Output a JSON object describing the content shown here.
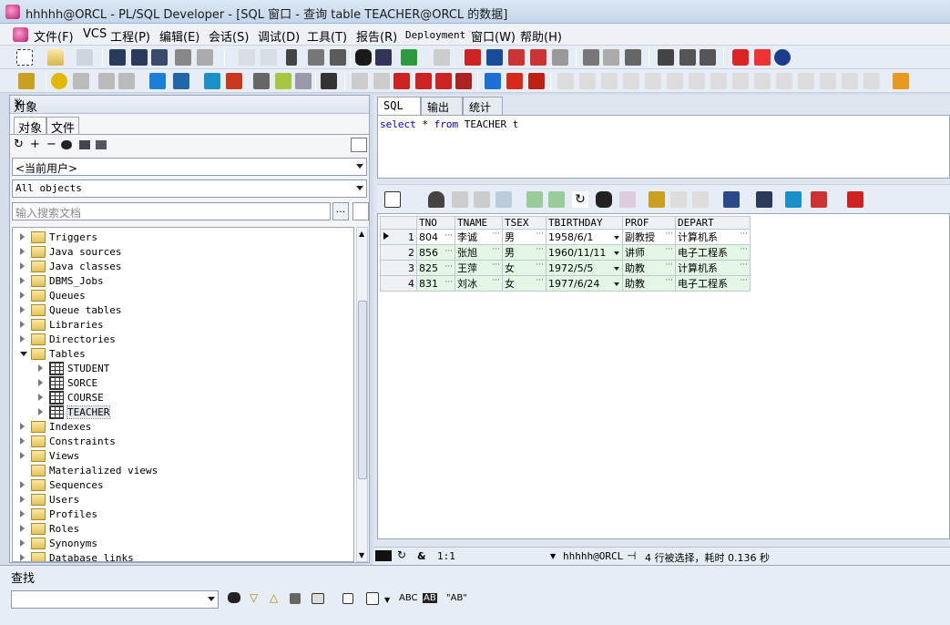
{
  "window": {
    "title": "hhhhh@ORCL - PL/SQL Developer - [SQL 窗口 - 查询 table TEACHER@ORCL 的数据]"
  },
  "menubar": [
    "文件(F)",
    "VCS",
    "工程(P)",
    "编辑(E)",
    "会话(S)",
    "调试(D)",
    "工具(T)",
    "报告(R)",
    "Deployment",
    "窗口(W)",
    "帮助(H)"
  ],
  "object_panel": {
    "header": "对象",
    "pin": "ᛘ",
    "close": "✕",
    "tabs": [
      "对象",
      "文件"
    ],
    "user_combo": "<当前用户>",
    "filter_combo": "All objects",
    "search_placeholder": "输入搜索文档",
    "search_more": "...",
    "tree": [
      {
        "label": "Triggers",
        "type": "folder",
        "level": 0,
        "expanded": false
      },
      {
        "label": "Java sources",
        "type": "folder",
        "level": 0,
        "expanded": false
      },
      {
        "label": "Java classes",
        "type": "folder",
        "level": 0,
        "expanded": false
      },
      {
        "label": "DBMS_Jobs",
        "type": "folder",
        "level": 0,
        "expanded": false
      },
      {
        "label": "Queues",
        "type": "folder",
        "level": 0,
        "expanded": false
      },
      {
        "label": "Queue tables",
        "type": "folder",
        "level": 0,
        "expanded": false
      },
      {
        "label": "Libraries",
        "type": "folder",
        "level": 0,
        "expanded": false
      },
      {
        "label": "Directories",
        "type": "folder",
        "level": 0,
        "expanded": false
      },
      {
        "label": "Tables",
        "type": "folder",
        "level": 0,
        "expanded": true
      },
      {
        "label": "STUDENT",
        "type": "table",
        "level": 1,
        "expanded": false
      },
      {
        "label": "SORCE",
        "type": "table",
        "level": 1,
        "expanded": false
      },
      {
        "label": "COURSE",
        "type": "table",
        "level": 1,
        "expanded": false
      },
      {
        "label": "TEACHER",
        "type": "table",
        "level": 1,
        "expanded": false,
        "selected": true
      },
      {
        "label": "Indexes",
        "type": "folder",
        "level": 0,
        "expanded": false
      },
      {
        "label": "Constraints",
        "type": "folder",
        "level": 0,
        "expanded": false
      },
      {
        "label": "Views",
        "type": "folder",
        "level": 0,
        "expanded": false
      },
      {
        "label": "Materialized views",
        "type": "folder",
        "level": 0,
        "expanded": false,
        "noexp": true
      },
      {
        "label": "Sequences",
        "type": "folder",
        "level": 0,
        "expanded": false
      },
      {
        "label": "Users",
        "type": "folder",
        "level": 0,
        "expanded": false
      },
      {
        "label": "Profiles",
        "type": "folder",
        "level": 0,
        "expanded": false
      },
      {
        "label": "Roles",
        "type": "folder",
        "level": 0,
        "expanded": false
      },
      {
        "label": "Synonyms",
        "type": "folder",
        "level": 0,
        "expanded": false
      },
      {
        "label": "Database links",
        "type": "folder",
        "level": 0,
        "expanded": false
      }
    ]
  },
  "editor": {
    "tabs": [
      "SQL",
      "输出",
      "统计"
    ],
    "sql": {
      "kw1": "select",
      "star": " * ",
      "kw2": "from",
      "rest": " TEACHER t"
    }
  },
  "grid": {
    "columns": [
      "TNO",
      "TNAME",
      "TSEX",
      "TBIRTHDAY",
      "PROF",
      "DEPART"
    ],
    "rows": [
      [
        "804",
        "李诚",
        "男",
        "1958/6/1",
        "副教授",
        "计算机系"
      ],
      [
        "856",
        "张旭",
        "男",
        "1960/11/11",
        "讲师",
        "电子工程系"
      ],
      [
        "825",
        "王萍",
        "女",
        "1972/5/5",
        "助教",
        "计算机系"
      ],
      [
        "831",
        "刘冰",
        "女",
        "1977/6/24",
        "助教",
        "电子工程系"
      ]
    ],
    "row_numbers": [
      "1",
      "2",
      "3",
      "4"
    ],
    "current_row": 0,
    "cell_ellipsis": "···"
  },
  "statusbar": {
    "amp": "&",
    "position": "1:1",
    "connection": "hhhhh@ORCL",
    "message": "4 行被选择，耗时 0.136 秒"
  },
  "findbar": {
    "label": "查找",
    "abc": "ABC",
    "abc_box": "AB",
    "quote_ab": "\"AB\""
  },
  "colors": {
    "accent": "#0a5fc8",
    "row_even": "#e4f7e4"
  }
}
